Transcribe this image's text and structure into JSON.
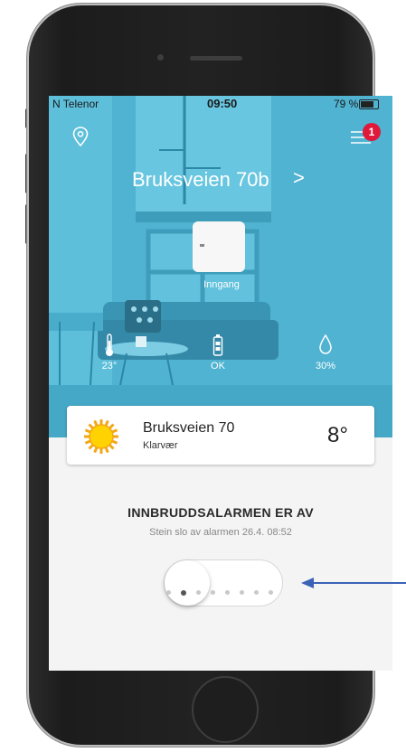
{
  "status_bar": {
    "carrier": "N Telenor",
    "time": "09:50",
    "battery_percent": "79 %"
  },
  "header": {
    "location_icon": "location-pin-icon",
    "menu_icon": "hamburger-menu-icon",
    "notification_count": "1",
    "address": "Bruksveien 70b",
    "chevron": ">"
  },
  "sensor": {
    "label": "Inngang"
  },
  "stats": {
    "temperature": "23°",
    "battery": "OK",
    "humidity": "30%",
    "temperature_icon": "thermometer-icon",
    "battery_icon": "battery-icon",
    "humidity_icon": "water-drop-icon"
  },
  "weather": {
    "place": "Bruksveien 70",
    "condition": "Klarvær",
    "temperature": "8°",
    "icon": "sun-icon"
  },
  "alarm": {
    "title": "INNBRUDDSALARMEN ER AV",
    "subtitle": "Stein slo av alarmen 26.4. 08:52",
    "toggle_on": false
  },
  "pager": {
    "count": 8,
    "active_index": 1
  },
  "colors": {
    "hero": "#4fb3d1",
    "badge": "#e0183a",
    "arrow": "#3b62b6"
  }
}
